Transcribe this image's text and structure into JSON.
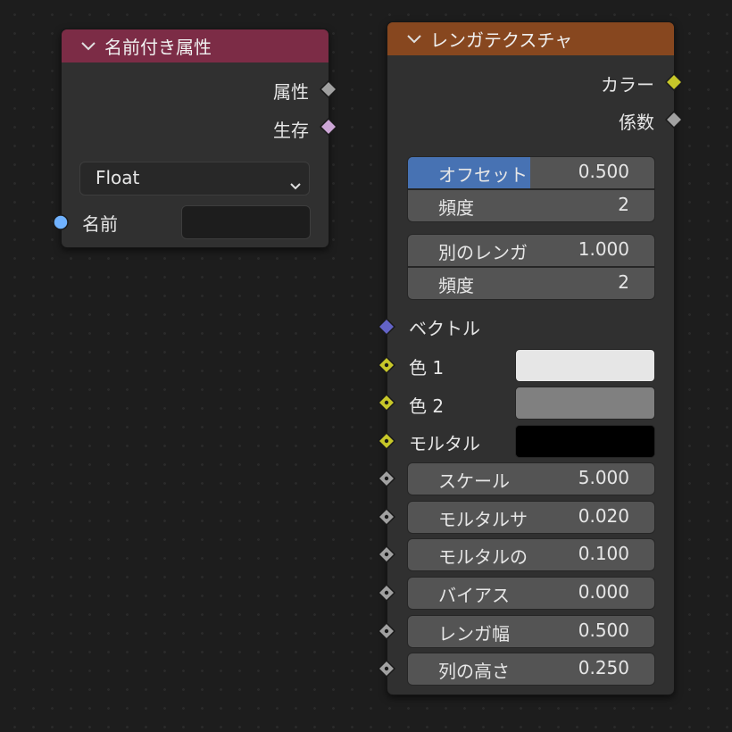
{
  "named_attribute_node": {
    "title": "名前付き属性",
    "header_color": "#7c2c46",
    "outputs": [
      "属性",
      "生存"
    ],
    "data_type": "Float",
    "name_input_label": "名前",
    "name_value": ""
  },
  "brick_texture_node": {
    "title": "レンガテクスチャ",
    "header_color": "#87471f",
    "outputs": [
      "カラー",
      "係数"
    ],
    "offset": {
      "label": "オフセット",
      "value": "0.500",
      "fraction": 0.5
    },
    "offset_frequency": {
      "label": "頻度",
      "value": "2"
    },
    "squash": {
      "label": "別のレンガ",
      "value": "1.000"
    },
    "squash_frequency": {
      "label": "頻度",
      "value": "2"
    },
    "vector_label": "ベクトル",
    "color_inputs": [
      {
        "label": "色 1",
        "color": "#e6e6e6"
      },
      {
        "label": "色 2",
        "color": "#808080"
      },
      {
        "label": "モルタル",
        "color": "#000000"
      }
    ],
    "value_inputs": [
      {
        "label": "スケール",
        "value": "5.000"
      },
      {
        "label": "モルタルサ",
        "value": "0.020"
      },
      {
        "label": "モルタルの",
        "value": "0.100"
      },
      {
        "label": "バイアス",
        "value": "0.000"
      },
      {
        "label": "レンガ幅",
        "value": "0.500"
      },
      {
        "label": "列の高さ",
        "value": "0.250"
      }
    ]
  }
}
